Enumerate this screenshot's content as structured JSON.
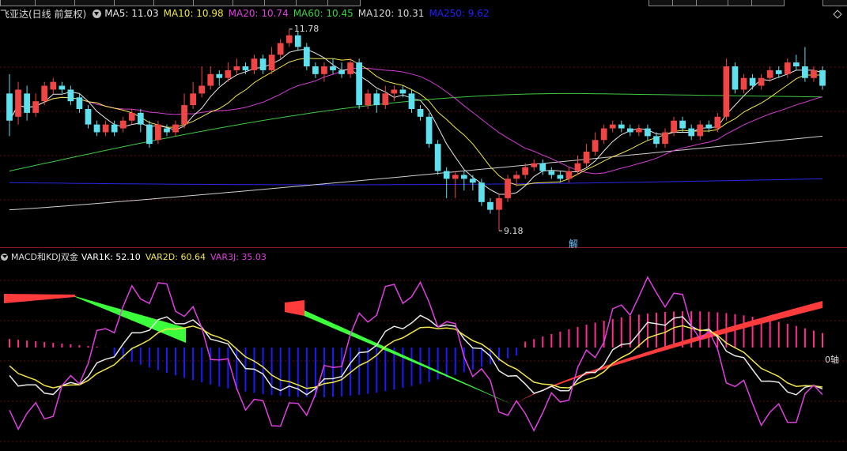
{
  "stock": {
    "title": "飞亚达(日线 前复权)",
    "ma": [
      {
        "label": "MA5: 11.03",
        "color": "#e8e8e8"
      },
      {
        "label": "MA10: 10.98",
        "color": "#f2e64a"
      },
      {
        "label": "MA20: 10.74",
        "color": "#e040e0"
      },
      {
        "label": "MA60: 10.45",
        "color": "#3fd23f"
      },
      {
        "label": "MA120: 10.31",
        "color": "#d8d8d8"
      },
      {
        "label": "MA250: 9.62",
        "color": "#2020ff"
      }
    ],
    "high_label": "11.78",
    "low_label": "9.18",
    "jie_label": "解"
  },
  "indicator": {
    "title": "MACD和KDJ双金",
    "vars": [
      {
        "label": "VAR1K: 52.10",
        "color": "#ffffff"
      },
      {
        "label": "VAR2D: 60.64",
        "color": "#f2e64a"
      },
      {
        "label": "VAR3J: 35.03",
        "color": "#e040e0"
      }
    ],
    "zero_label": "0轴"
  },
  "colors": {
    "up": "#f04545",
    "down": "#5ee0ee",
    "ma5": "#e8e8e8",
    "ma10": "#f2e64a",
    "ma20": "#d33cd3",
    "ma60": "#3fc93f",
    "ma120": "#cfcfcf",
    "ma250": "#2828e6",
    "macd_pos": "#ff2d8e",
    "macd_neg": "#1a1aff",
    "band_up": "#ff3b3b",
    "band_down": "#3bff3b"
  },
  "chart_data": {
    "type": "candlestick",
    "y_label_high": 11.78,
    "y_label_low": 9.18,
    "candles": [
      [
        10.95,
        10.6,
        11.2,
        10.4
      ],
      [
        10.65,
        11.0,
        11.1,
        10.55
      ],
      [
        10.95,
        10.7,
        11.05,
        10.6
      ],
      [
        10.7,
        10.85,
        10.95,
        10.65
      ],
      [
        10.85,
        11.05,
        11.1,
        10.8
      ],
      [
        11.0,
        11.1,
        11.15,
        10.95
      ],
      [
        11.05,
        11.0,
        11.1,
        10.95
      ],
      [
        11.0,
        10.85,
        11.05,
        10.8
      ],
      [
        10.9,
        10.75,
        10.95,
        10.7
      ],
      [
        10.75,
        10.55,
        10.8,
        10.5
      ],
      [
        10.55,
        10.45,
        10.6,
        10.4
      ],
      [
        10.45,
        10.55,
        10.6,
        10.4
      ],
      [
        10.55,
        10.45,
        10.6,
        10.4
      ],
      [
        10.5,
        10.6,
        10.65,
        10.45
      ],
      [
        10.6,
        10.7,
        10.75,
        10.55
      ],
      [
        10.7,
        10.55,
        10.75,
        10.45
      ],
      [
        10.55,
        10.3,
        10.6,
        10.25
      ],
      [
        10.35,
        10.55,
        10.6,
        10.3
      ],
      [
        10.5,
        10.45,
        10.55,
        10.4
      ],
      [
        10.45,
        10.55,
        10.6,
        10.4
      ],
      [
        10.55,
        10.8,
        10.95,
        10.5
      ],
      [
        10.8,
        10.95,
        11.1,
        10.75
      ],
      [
        10.95,
        11.05,
        11.3,
        10.9
      ],
      [
        11.05,
        11.2,
        11.3,
        11.0
      ],
      [
        11.2,
        11.15,
        11.25,
        11.05
      ],
      [
        11.15,
        11.25,
        11.35,
        11.1
      ],
      [
        11.25,
        11.3,
        11.4,
        11.2
      ],
      [
        11.3,
        11.25,
        11.35,
        11.2
      ],
      [
        11.25,
        11.4,
        11.45,
        11.2
      ],
      [
        11.4,
        11.25,
        11.45,
        11.2
      ],
      [
        11.25,
        11.45,
        11.55,
        11.2
      ],
      [
        11.45,
        11.6,
        11.65,
        11.4
      ],
      [
        11.6,
        11.7,
        11.78,
        11.55
      ],
      [
        11.7,
        11.55,
        11.75,
        11.5
      ],
      [
        11.55,
        11.3,
        11.6,
        11.25
      ],
      [
        11.3,
        11.2,
        11.35,
        11.15
      ],
      [
        11.2,
        11.3,
        11.35,
        11.1
      ],
      [
        11.3,
        11.25,
        11.4,
        11.2
      ],
      [
        11.25,
        11.2,
        11.35,
        11.15
      ],
      [
        11.2,
        11.35,
        11.4,
        11.15
      ],
      [
        11.35,
        10.8,
        11.4,
        10.75
      ],
      [
        10.8,
        10.95,
        11.0,
        10.75
      ],
      [
        10.95,
        10.8,
        11.0,
        10.7
      ],
      [
        10.8,
        10.95,
        11.05,
        10.75
      ],
      [
        10.95,
        11.0,
        11.05,
        10.85
      ],
      [
        11.0,
        10.95,
        11.05,
        10.9
      ],
      [
        10.95,
        10.75,
        11.0,
        10.7
      ],
      [
        10.75,
        10.65,
        10.8,
        10.6
      ],
      [
        10.65,
        10.3,
        10.7,
        10.25
      ],
      [
        10.3,
        9.95,
        10.35,
        9.9
      ],
      [
        9.95,
        9.85,
        10.0,
        9.6
      ],
      [
        9.85,
        9.9,
        9.95,
        9.6
      ],
      [
        9.9,
        9.85,
        9.95,
        9.7
      ],
      [
        9.85,
        9.8,
        9.9,
        9.7
      ],
      [
        9.8,
        9.55,
        9.85,
        9.5
      ],
      [
        9.55,
        9.45,
        9.6,
        9.4
      ],
      [
        9.45,
        9.6,
        9.65,
        9.18
      ],
      [
        9.6,
        9.85,
        9.9,
        9.55
      ],
      [
        9.85,
        9.9,
        9.95,
        9.75
      ],
      [
        9.9,
        10.0,
        10.05,
        9.85
      ],
      [
        10.0,
        10.05,
        10.1,
        9.95
      ],
      [
        10.05,
        9.95,
        10.1,
        9.9
      ],
      [
        9.95,
        9.9,
        10.0,
        9.85
      ],
      [
        9.9,
        9.85,
        9.95,
        9.8
      ],
      [
        9.85,
        9.95,
        10.0,
        9.8
      ],
      [
        9.95,
        10.05,
        10.15,
        9.9
      ],
      [
        10.05,
        10.2,
        10.3,
        10.0
      ],
      [
        10.2,
        10.35,
        10.45,
        10.15
      ],
      [
        10.35,
        10.5,
        10.55,
        10.3
      ],
      [
        10.5,
        10.55,
        10.6,
        10.45
      ],
      [
        10.55,
        10.5,
        10.6,
        10.45
      ],
      [
        10.5,
        10.45,
        10.55,
        10.4
      ],
      [
        10.45,
        10.5,
        10.55,
        10.4
      ],
      [
        10.5,
        10.4,
        10.55,
        10.35
      ],
      [
        10.4,
        10.3,
        10.45,
        10.25
      ],
      [
        10.3,
        10.45,
        10.5,
        10.25
      ],
      [
        10.45,
        10.6,
        10.65,
        10.4
      ],
      [
        10.6,
        10.5,
        10.65,
        10.45
      ],
      [
        10.5,
        10.4,
        10.55,
        10.35
      ],
      [
        10.4,
        10.55,
        10.6,
        10.35
      ],
      [
        10.55,
        10.5,
        10.6,
        10.45
      ],
      [
        10.5,
        10.65,
        10.7,
        10.45
      ],
      [
        10.65,
        11.3,
        11.4,
        10.6
      ],
      [
        11.3,
        11.0,
        11.35,
        10.95
      ],
      [
        11.0,
        11.15,
        11.2,
        10.95
      ],
      [
        11.15,
        11.05,
        11.2,
        11.0
      ],
      [
        11.05,
        11.15,
        11.2,
        11.0
      ],
      [
        11.15,
        11.25,
        11.3,
        11.1
      ],
      [
        11.25,
        11.2,
        11.3,
        11.15
      ],
      [
        11.2,
        11.35,
        11.4,
        11.15
      ],
      [
        11.35,
        11.3,
        11.45,
        11.25
      ],
      [
        11.3,
        11.15,
        11.55,
        11.1
      ],
      [
        11.15,
        11.25,
        11.3,
        11.1
      ],
      [
        11.25,
        11.05,
        11.3,
        11.0
      ]
    ]
  }
}
